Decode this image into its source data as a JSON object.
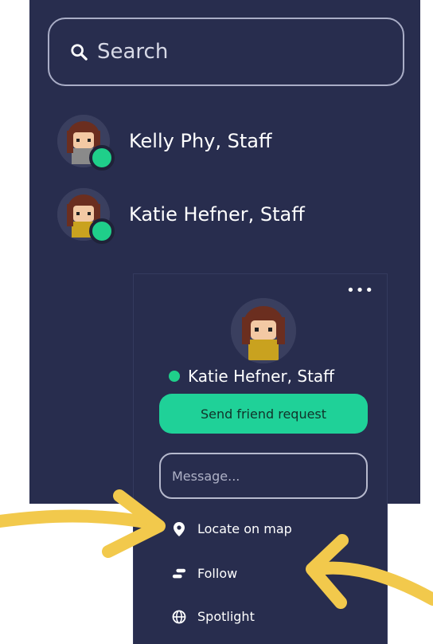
{
  "search": {
    "placeholder": "Search"
  },
  "users": [
    {
      "name": "Kelly Phy, Staff",
      "online": true
    },
    {
      "name": "Katie Hefner, Staff",
      "online": true
    }
  ],
  "profile_card": {
    "more_label": "•••",
    "name": "Katie Hefner, Staff",
    "friend_button": "Send friend request",
    "message_placeholder": "Message...",
    "menu": [
      {
        "label": "Locate on map",
        "icon": "map-pin-icon"
      },
      {
        "label": "Follow",
        "icon": "follow-icon"
      },
      {
        "label": "Spotlight",
        "icon": "globe-icon"
      }
    ]
  },
  "colors": {
    "panel": "#282d4e",
    "online": "#1fcf8a",
    "button": "#1fd198",
    "annotation_arrow": "#f2c94c"
  }
}
